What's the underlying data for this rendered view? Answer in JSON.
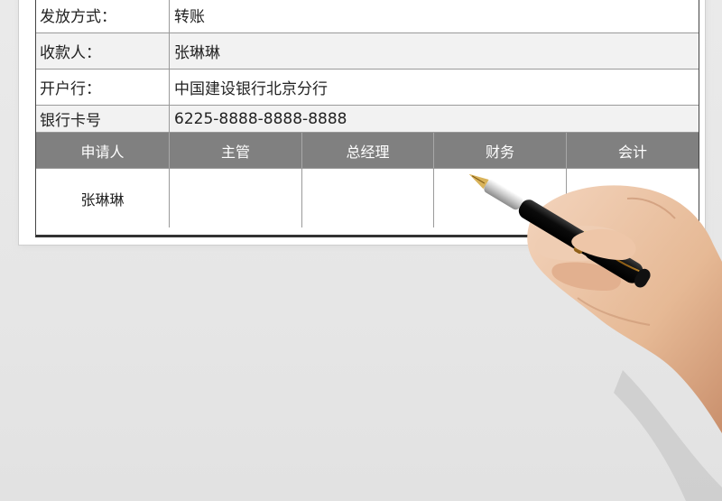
{
  "form": {
    "rows": [
      {
        "label": "发放方式：",
        "value": "转账"
      },
      {
        "label": "收款人：",
        "value": "张琳琳"
      },
      {
        "label": "开户行：",
        "value": "中国建设银行北京分行"
      },
      {
        "label": "银行卡号",
        "value": "6225-8888-8888-8888"
      }
    ],
    "approval_headers": [
      "申请人",
      "主管",
      "总经理",
      "财务",
      "会计"
    ],
    "approval_values": [
      "张琳琳",
      "",
      "",
      "",
      ""
    ]
  },
  "illustration": {
    "icon": "hand-holding-fountain-pen-icon",
    "colors": {
      "pen_body": "#111111",
      "pen_gold": "#c8a040",
      "skin": "#e9c2a6"
    }
  }
}
